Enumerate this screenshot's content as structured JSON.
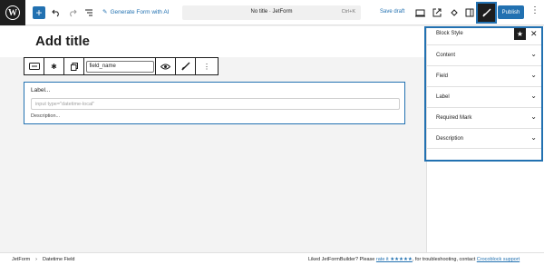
{
  "topbar": {
    "generate_ai": "Generate Form with AI",
    "doc_title": "No title · JetForm",
    "shortcut": "Ctrl+K",
    "save_draft": "Save draft",
    "publish": "Publish",
    "accent": "#2271b1"
  },
  "canvas": {
    "title_placeholder": "Add title",
    "toolbar": {
      "field_name": "field_name"
    },
    "field": {
      "label": "Label...",
      "input_placeholder": "input type=\"datetime-local\"",
      "description": "Description..."
    }
  },
  "sidebar": {
    "title": "Block Style",
    "sections": [
      "Content",
      "Field",
      "Label",
      "Required Mark",
      "Description"
    ]
  },
  "footer": {
    "breadcrumb": [
      "JetForm",
      "Datetime Field"
    ],
    "promo_prefix": "Liked JetFormBuilder? Please ",
    "promo_rate": "rate it ★★★★★",
    "promo_mid": ", for troubleshooting, contact ",
    "promo_support": "Crocoblock support"
  }
}
